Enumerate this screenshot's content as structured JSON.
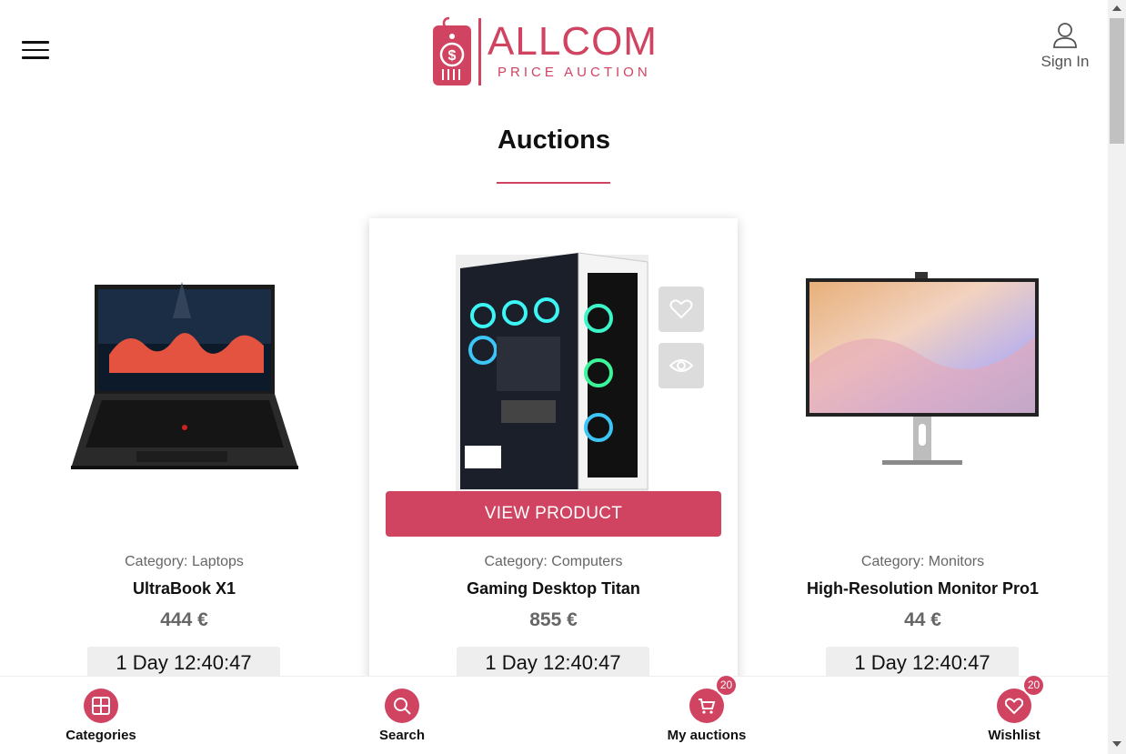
{
  "header": {
    "logo_main": "ALLCOM",
    "logo_sub": "PRICE AUCTION",
    "signin_label": "Sign In"
  },
  "page": {
    "title": "Auctions"
  },
  "products": [
    {
      "category_label": "Category:",
      "category": "Laptops",
      "name": "UltraBook X1",
      "price": "444 €",
      "timer": "1 Day 12:40:47"
    },
    {
      "category_label": "Category:",
      "category": "Computers",
      "name": "Gaming Desktop Titan",
      "price": "855 €",
      "timer": "1 Day 12:40:47",
      "button": "VIEW PRODUCT"
    },
    {
      "category_label": "Category:",
      "category": "Monitors",
      "name": "High-Resolution Monitor Pro1",
      "price": "44 €",
      "timer": "1 Day 12:40:47"
    }
  ],
  "bottom_nav": {
    "categories": "Categories",
    "search": "Search",
    "my_auctions": "My auctions",
    "my_auctions_badge": "20",
    "wishlist": "Wishlist",
    "wishlist_badge": "20"
  },
  "colors": {
    "accent": "#d04462"
  }
}
